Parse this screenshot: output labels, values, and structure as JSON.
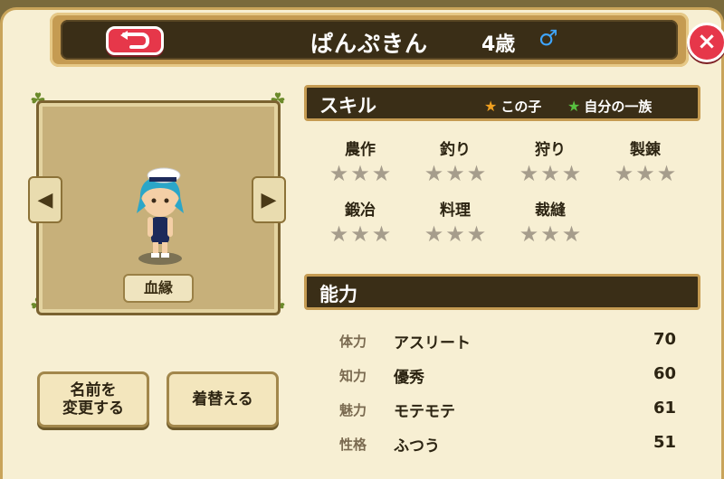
{
  "header": {
    "title": "ぱんぷきん",
    "age": "4歳",
    "gender_symbol": "♂",
    "close_label": "×"
  },
  "portrait": {
    "lineage_label": "血縁",
    "prev_arrow": "◀",
    "next_arrow": "▶"
  },
  "buttons": {
    "rename_line1": "名前を",
    "rename_line2": "変更する",
    "change_clothes": "着替える"
  },
  "skills_section": {
    "title": "スキル",
    "legend_child": "この子",
    "legend_clan": "自分の一族",
    "legend_child_color": "#f0a020",
    "legend_clan_color": "#58c040",
    "skills": [
      {
        "name": "農作",
        "stars": 0
      },
      {
        "name": "釣り",
        "stars": 0
      },
      {
        "name": "狩り",
        "stars": 0
      },
      {
        "name": "製錬",
        "stars": 0
      },
      {
        "name": "鍛冶",
        "stars": 0
      },
      {
        "name": "料理",
        "stars": 0
      },
      {
        "name": "裁縫",
        "stars": 0
      }
    ]
  },
  "abilities_section": {
    "title": "能力",
    "stats": [
      {
        "label": "体力",
        "desc": "アスリート",
        "value": "70"
      },
      {
        "label": "知力",
        "desc": "優秀",
        "value": "60"
      },
      {
        "label": "魅力",
        "desc": "モテモテ",
        "value": "61"
      },
      {
        "label": "性格",
        "desc": "ふつう",
        "value": "51"
      }
    ]
  },
  "colors": {
    "accent_red": "#e6374a",
    "panel_bg": "#f7efd3",
    "bar_dark": "#3a2e17",
    "gold_border": "#c59b52"
  }
}
